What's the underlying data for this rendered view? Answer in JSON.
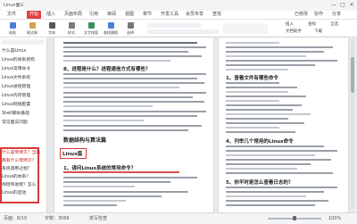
{
  "titlebar": {
    "tab_title": "Linux面试题",
    "minimize": "—",
    "maximize": "□",
    "close": "✕"
  },
  "menubar": {
    "items": [
      "文件",
      "开始",
      "插入",
      "页面布局",
      "引用",
      "审阅",
      "视图",
      "章节",
      "开发工具",
      "会员专享",
      "查找"
    ],
    "active_index": 1,
    "right_items": [
      "已修改",
      "协作",
      "分享"
    ]
  },
  "ribbon": {
    "buttons": [
      {
        "label": "粘贴",
        "icon": "paste-icon",
        "color": "#4a7fd6"
      },
      {
        "label": "格式刷",
        "icon": "format-brush-icon",
        "color": "#d6a14a"
      },
      {
        "label": "字体",
        "icon": "font-icon",
        "color": "#555555"
      },
      {
        "label": "样式",
        "icon": "style-icon",
        "color": "#7a7a7a"
      },
      {
        "label": "文字排版",
        "icon": "text-layout-icon",
        "color": "#3a8f5a"
      },
      {
        "label": "查找替换",
        "icon": "find-replace-icon",
        "color": "#4a7fd6"
      },
      {
        "label": "选择",
        "icon": "select-icon",
        "color": "#777777"
      }
    ],
    "right_buttons": [
      "插入",
      "查找",
      "全选"
    ],
    "right_lower": [
      "文档助手",
      "下载"
    ]
  },
  "left_panel": {
    "items": [
      "什么是Linux",
      "Linux的体系结构",
      "Linux常用命令",
      "Linux文件系统",
      "Linux进程管理",
      "Linux内存管理",
      "Linux网络配置",
      "Shell脚本基础",
      "常见面试问题"
    ],
    "highlight_lines": [
      "什么是零拷贝？当前",
      "都有什么零拷贝？",
      "系统调用过程？",
      "Linux的体系？",
      "线程和进程？怎么",
      "Linux的启动"
    ]
  },
  "page1": {
    "section_title": "8、进程是什么？进程通信方式有哪些？",
    "subsection_title": "数据结构与算法篇",
    "boxed_label": "Linux篇",
    "question_title": "1、请问Linux系统的常用命令？"
  },
  "page2": {
    "heading1": "1、查看文件有哪些命令",
    "heading2": "4、列举几个常用的Linux命令",
    "heading3": "5、你平时是怎么查看日志的？"
  },
  "statusbar": {
    "page_info": "页面：8/10",
    "word_count": "字数：3066",
    "spell": "拼写检查",
    "zoom": "100%"
  },
  "colors": {
    "accent": "#e34040",
    "highlight_red": "#d93a3a"
  }
}
